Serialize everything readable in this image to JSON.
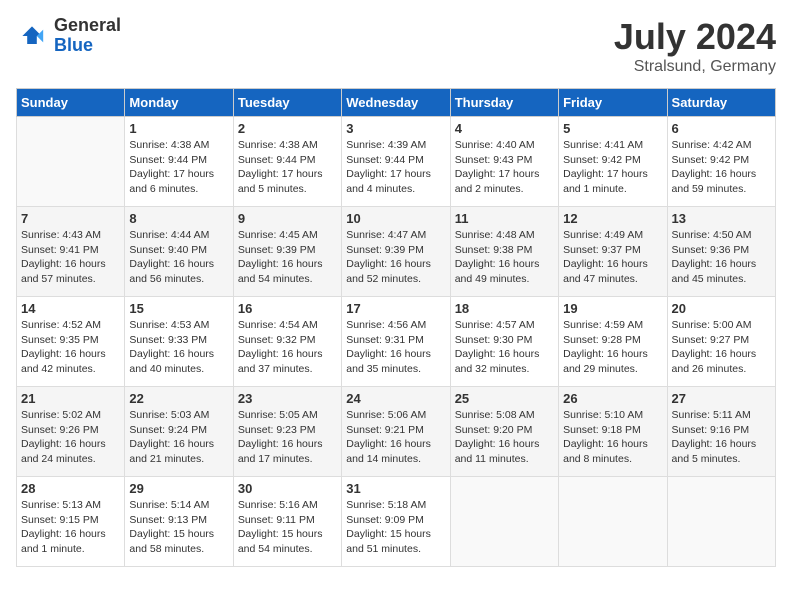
{
  "logo": {
    "general": "General",
    "blue": "Blue"
  },
  "title": {
    "month_year": "July 2024",
    "location": "Stralsund, Germany"
  },
  "headers": [
    "Sunday",
    "Monday",
    "Tuesday",
    "Wednesday",
    "Thursday",
    "Friday",
    "Saturday"
  ],
  "weeks": [
    [
      {
        "day": "",
        "sunrise": "",
        "sunset": "",
        "daylight": ""
      },
      {
        "day": "1",
        "sunrise": "Sunrise: 4:38 AM",
        "sunset": "Sunset: 9:44 PM",
        "daylight": "Daylight: 17 hours and 6 minutes."
      },
      {
        "day": "2",
        "sunrise": "Sunrise: 4:38 AM",
        "sunset": "Sunset: 9:44 PM",
        "daylight": "Daylight: 17 hours and 5 minutes."
      },
      {
        "day": "3",
        "sunrise": "Sunrise: 4:39 AM",
        "sunset": "Sunset: 9:44 PM",
        "daylight": "Daylight: 17 hours and 4 minutes."
      },
      {
        "day": "4",
        "sunrise": "Sunrise: 4:40 AM",
        "sunset": "Sunset: 9:43 PM",
        "daylight": "Daylight: 17 hours and 2 minutes."
      },
      {
        "day": "5",
        "sunrise": "Sunrise: 4:41 AM",
        "sunset": "Sunset: 9:42 PM",
        "daylight": "Daylight: 17 hours and 1 minute."
      },
      {
        "day": "6",
        "sunrise": "Sunrise: 4:42 AM",
        "sunset": "Sunset: 9:42 PM",
        "daylight": "Daylight: 16 hours and 59 minutes."
      }
    ],
    [
      {
        "day": "7",
        "sunrise": "Sunrise: 4:43 AM",
        "sunset": "Sunset: 9:41 PM",
        "daylight": "Daylight: 16 hours and 57 minutes."
      },
      {
        "day": "8",
        "sunrise": "Sunrise: 4:44 AM",
        "sunset": "Sunset: 9:40 PM",
        "daylight": "Daylight: 16 hours and 56 minutes."
      },
      {
        "day": "9",
        "sunrise": "Sunrise: 4:45 AM",
        "sunset": "Sunset: 9:39 PM",
        "daylight": "Daylight: 16 hours and 54 minutes."
      },
      {
        "day": "10",
        "sunrise": "Sunrise: 4:47 AM",
        "sunset": "Sunset: 9:39 PM",
        "daylight": "Daylight: 16 hours and 52 minutes."
      },
      {
        "day": "11",
        "sunrise": "Sunrise: 4:48 AM",
        "sunset": "Sunset: 9:38 PM",
        "daylight": "Daylight: 16 hours and 49 minutes."
      },
      {
        "day": "12",
        "sunrise": "Sunrise: 4:49 AM",
        "sunset": "Sunset: 9:37 PM",
        "daylight": "Daylight: 16 hours and 47 minutes."
      },
      {
        "day": "13",
        "sunrise": "Sunrise: 4:50 AM",
        "sunset": "Sunset: 9:36 PM",
        "daylight": "Daylight: 16 hours and 45 minutes."
      }
    ],
    [
      {
        "day": "14",
        "sunrise": "Sunrise: 4:52 AM",
        "sunset": "Sunset: 9:35 PM",
        "daylight": "Daylight: 16 hours and 42 minutes."
      },
      {
        "day": "15",
        "sunrise": "Sunrise: 4:53 AM",
        "sunset": "Sunset: 9:33 PM",
        "daylight": "Daylight: 16 hours and 40 minutes."
      },
      {
        "day": "16",
        "sunrise": "Sunrise: 4:54 AM",
        "sunset": "Sunset: 9:32 PM",
        "daylight": "Daylight: 16 hours and 37 minutes."
      },
      {
        "day": "17",
        "sunrise": "Sunrise: 4:56 AM",
        "sunset": "Sunset: 9:31 PM",
        "daylight": "Daylight: 16 hours and 35 minutes."
      },
      {
        "day": "18",
        "sunrise": "Sunrise: 4:57 AM",
        "sunset": "Sunset: 9:30 PM",
        "daylight": "Daylight: 16 hours and 32 minutes."
      },
      {
        "day": "19",
        "sunrise": "Sunrise: 4:59 AM",
        "sunset": "Sunset: 9:28 PM",
        "daylight": "Daylight: 16 hours and 29 minutes."
      },
      {
        "day": "20",
        "sunrise": "Sunrise: 5:00 AM",
        "sunset": "Sunset: 9:27 PM",
        "daylight": "Daylight: 16 hours and 26 minutes."
      }
    ],
    [
      {
        "day": "21",
        "sunrise": "Sunrise: 5:02 AM",
        "sunset": "Sunset: 9:26 PM",
        "daylight": "Daylight: 16 hours and 24 minutes."
      },
      {
        "day": "22",
        "sunrise": "Sunrise: 5:03 AM",
        "sunset": "Sunset: 9:24 PM",
        "daylight": "Daylight: 16 hours and 21 minutes."
      },
      {
        "day": "23",
        "sunrise": "Sunrise: 5:05 AM",
        "sunset": "Sunset: 9:23 PM",
        "daylight": "Daylight: 16 hours and 17 minutes."
      },
      {
        "day": "24",
        "sunrise": "Sunrise: 5:06 AM",
        "sunset": "Sunset: 9:21 PM",
        "daylight": "Daylight: 16 hours and 14 minutes."
      },
      {
        "day": "25",
        "sunrise": "Sunrise: 5:08 AM",
        "sunset": "Sunset: 9:20 PM",
        "daylight": "Daylight: 16 hours and 11 minutes."
      },
      {
        "day": "26",
        "sunrise": "Sunrise: 5:10 AM",
        "sunset": "Sunset: 9:18 PM",
        "daylight": "Daylight: 16 hours and 8 minutes."
      },
      {
        "day": "27",
        "sunrise": "Sunrise: 5:11 AM",
        "sunset": "Sunset: 9:16 PM",
        "daylight": "Daylight: 16 hours and 5 minutes."
      }
    ],
    [
      {
        "day": "28",
        "sunrise": "Sunrise: 5:13 AM",
        "sunset": "Sunset: 9:15 PM",
        "daylight": "Daylight: 16 hours and 1 minute."
      },
      {
        "day": "29",
        "sunrise": "Sunrise: 5:14 AM",
        "sunset": "Sunset: 9:13 PM",
        "daylight": "Daylight: 15 hours and 58 minutes."
      },
      {
        "day": "30",
        "sunrise": "Sunrise: 5:16 AM",
        "sunset": "Sunset: 9:11 PM",
        "daylight": "Daylight: 15 hours and 54 minutes."
      },
      {
        "day": "31",
        "sunrise": "Sunrise: 5:18 AM",
        "sunset": "Sunset: 9:09 PM",
        "daylight": "Daylight: 15 hours and 51 minutes."
      },
      {
        "day": "",
        "sunrise": "",
        "sunset": "",
        "daylight": ""
      },
      {
        "day": "",
        "sunrise": "",
        "sunset": "",
        "daylight": ""
      },
      {
        "day": "",
        "sunrise": "",
        "sunset": "",
        "daylight": ""
      }
    ]
  ]
}
